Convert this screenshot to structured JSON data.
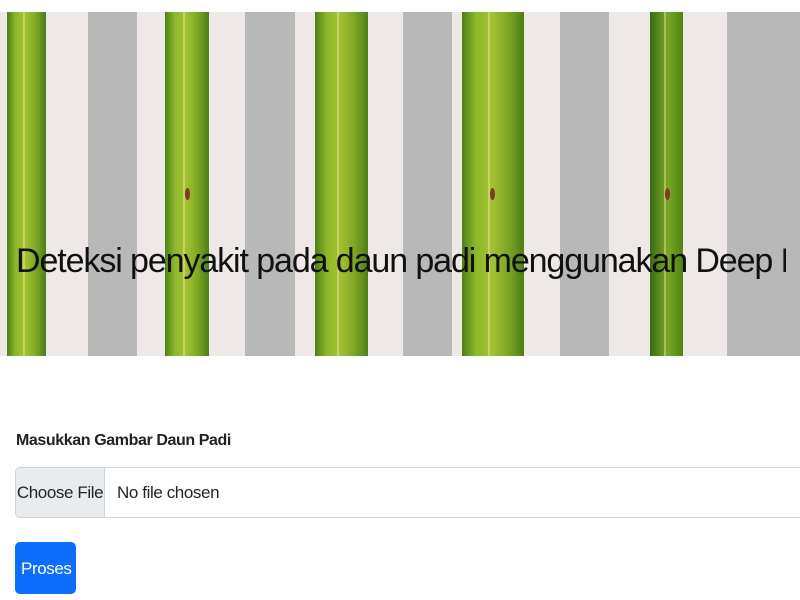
{
  "hero": {
    "title": "Deteksi penyakit pada daun padi menggunakan Deep Learning"
  },
  "form": {
    "label": "Masukkan Gambar Daun Padi",
    "choose_file_label": "Choose File",
    "file_status": "No file chosen",
    "submit_label": "Proses"
  },
  "colors": {
    "primary_button": "#0d6efd",
    "hero_title": "#111111",
    "input_border": "#ced4da",
    "file_button_bg": "#e9ecef"
  },
  "icons": {
    "hero_image": "rice-leaf-image"
  }
}
